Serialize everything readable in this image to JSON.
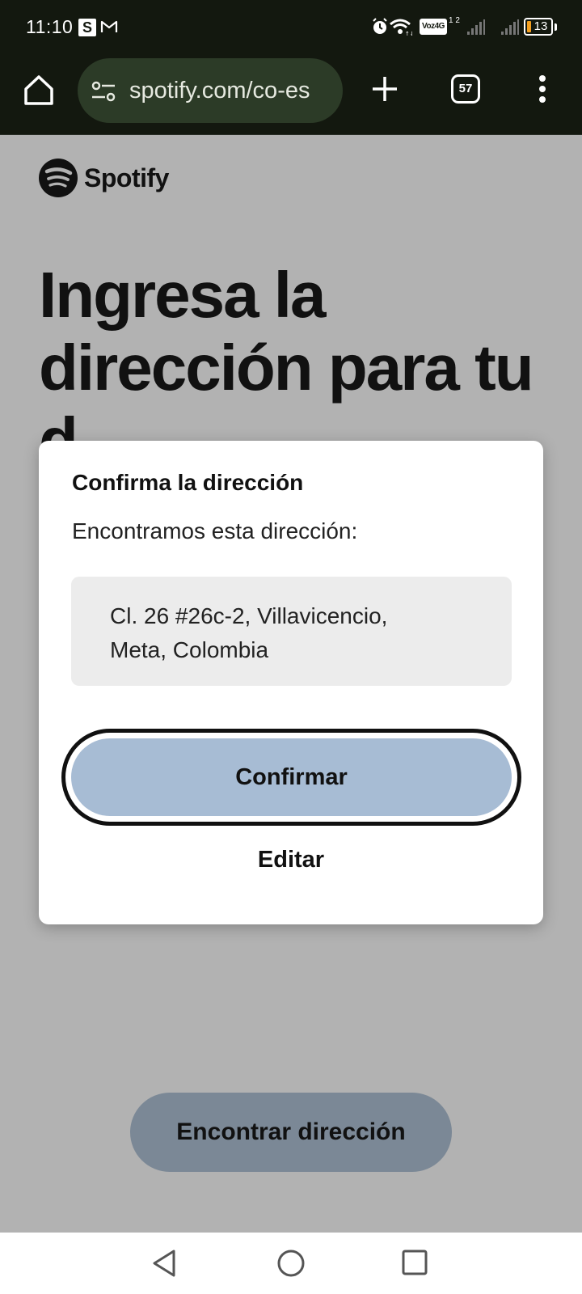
{
  "status_bar": {
    "time": "11:10",
    "notification_s": "S",
    "volte": "Voz4G",
    "sim": "1 2",
    "battery": "13"
  },
  "browser": {
    "url": "spotify.com/co-es",
    "tab_count": "57"
  },
  "page": {
    "brand": "Spotify",
    "headline": "Ingresa la dirección para tu d",
    "find_address_button": "Encontrar dirección"
  },
  "modal": {
    "title": "Confirma la dirección",
    "text": "Encontramos esta dirección:",
    "address_line1": "Cl. 26 #26c-2, Villavicencio,",
    "address_line2": "Meta, Colombia",
    "confirm_button": "Confirmar",
    "edit_button": "Editar"
  },
  "colors": {
    "status_bg": "#13180f",
    "url_pill": "#2c3b27",
    "page_overlay": "#b2b2b2",
    "confirm_button": "#a7bcd4",
    "find_button": "#7b8896",
    "battery_fill": "#f4a020"
  }
}
